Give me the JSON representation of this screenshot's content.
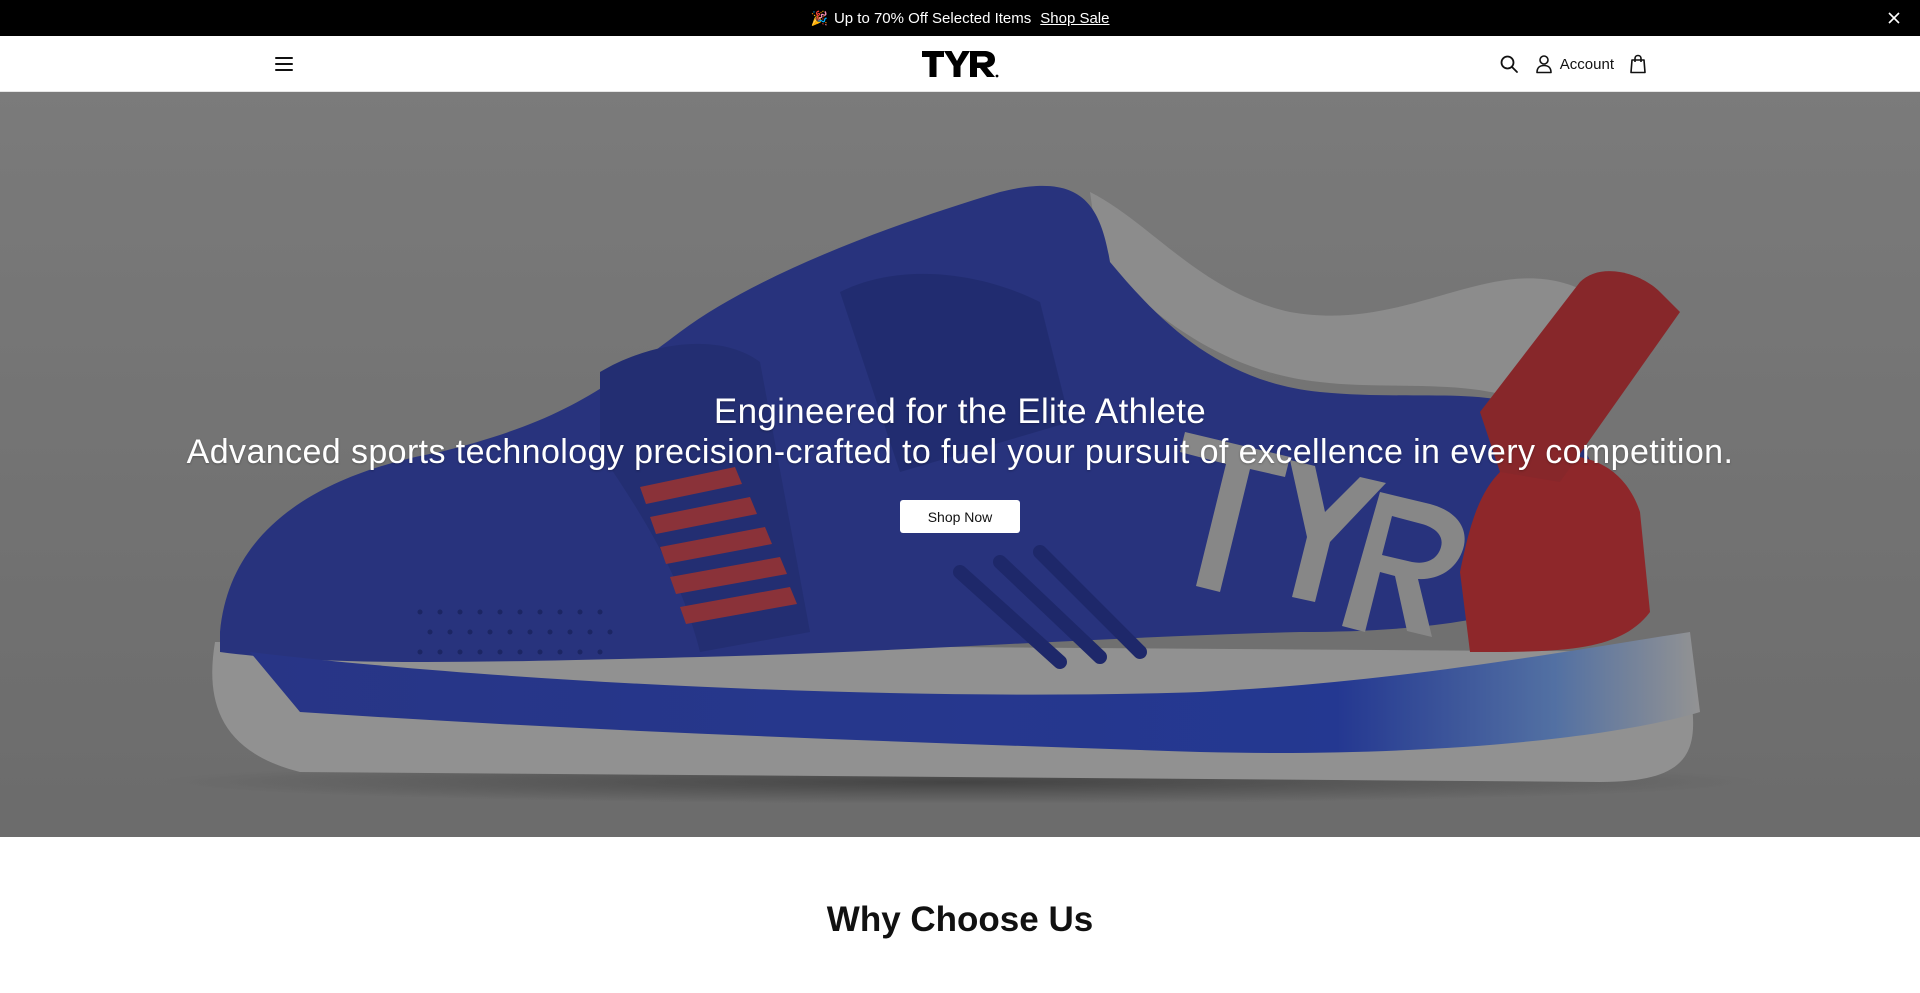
{
  "announcement": {
    "text": "Up to 70% Off Selected Items",
    "link": "Shop Sale",
    "emoji": "🎉",
    "close_icon": "close-icon"
  },
  "header": {
    "logo_text": "TYR",
    "menu_icon": "hamburger-icon",
    "search_icon": "search-icon",
    "account_label": "Account",
    "account_icon": "user-icon",
    "bag_icon": "shopping-bag-icon"
  },
  "hero": {
    "title": "Engineered for the Elite Athlete",
    "subtitle": "Advanced sports technology precision-crafted to fuel your pursuit of excellence in every competition.",
    "cta": "Shop Now"
  },
  "section": {
    "title": "Why Choose Us"
  },
  "colors": {
    "announcement_bg": "#000000",
    "shoe_blue": "#3a4fc4",
    "shoe_red": "#d43a3a",
    "hero_bg": "#a8a8a8"
  }
}
